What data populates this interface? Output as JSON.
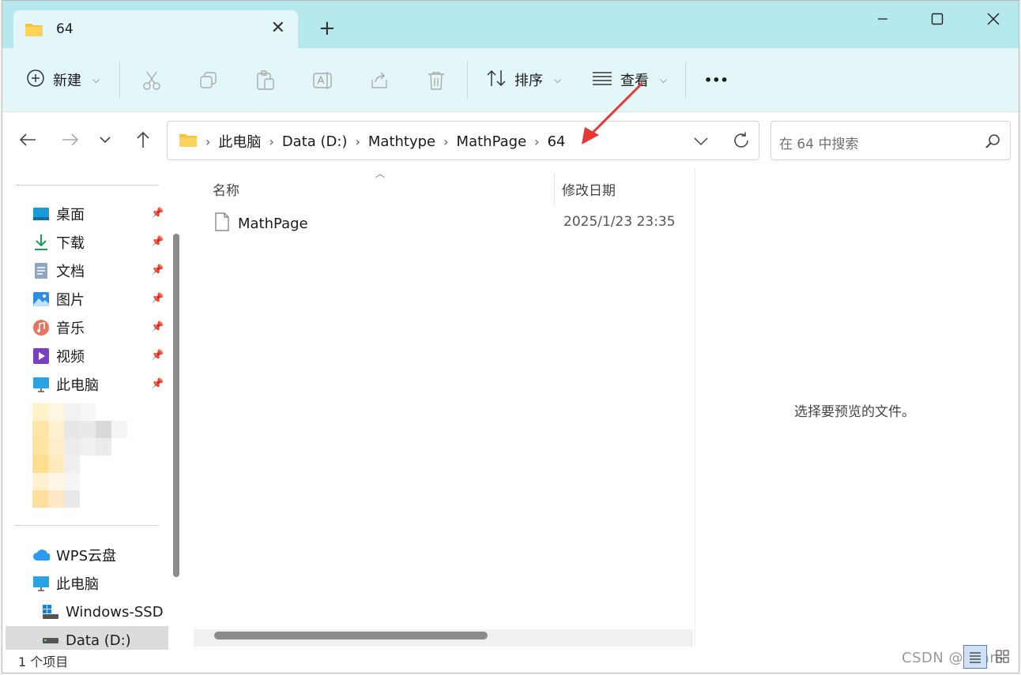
{
  "tab": {
    "title": "64"
  },
  "toolbar": {
    "new_label": "新建",
    "sort_label": "排序",
    "view_label": "查看",
    "more_label": "•••"
  },
  "address": {
    "crumbs": [
      "此电脑",
      "Data (D:)",
      "Mathtype",
      "MathPage",
      "64"
    ]
  },
  "search": {
    "placeholder": "在 64 中搜索"
  },
  "sidebar": {
    "pinned": [
      {
        "label": "桌面",
        "icon": "desktop-icon"
      },
      {
        "label": "下载",
        "icon": "download-icon"
      },
      {
        "label": "文档",
        "icon": "documents-icon"
      },
      {
        "label": "图片",
        "icon": "pictures-icon"
      },
      {
        "label": "音乐",
        "icon": "music-icon"
      },
      {
        "label": "视频",
        "icon": "videos-icon"
      },
      {
        "label": "此电脑",
        "icon": "computer-icon"
      }
    ],
    "locations": [
      {
        "label": "WPS云盘",
        "icon": "cloud-icon"
      },
      {
        "label": "此电脑",
        "icon": "computer-icon"
      },
      {
        "label": "Windows-SSD (",
        "icon": "windows-drive-icon"
      },
      {
        "label": "Data (D:)",
        "icon": "drive-icon"
      }
    ]
  },
  "columns": {
    "name": "名称",
    "modified": "修改日期"
  },
  "files": [
    {
      "name": "MathPage",
      "modified": "2025/1/23 23:35"
    }
  ],
  "preview": {
    "message": "选择要预览的文件。"
  },
  "status": {
    "count": "1 个项目"
  },
  "watermark": "CSDN @Lean-",
  "colors": {
    "titlebar": "#b6e9ed",
    "commandbar": "#e4f7f8",
    "annotation": "#e53935"
  }
}
